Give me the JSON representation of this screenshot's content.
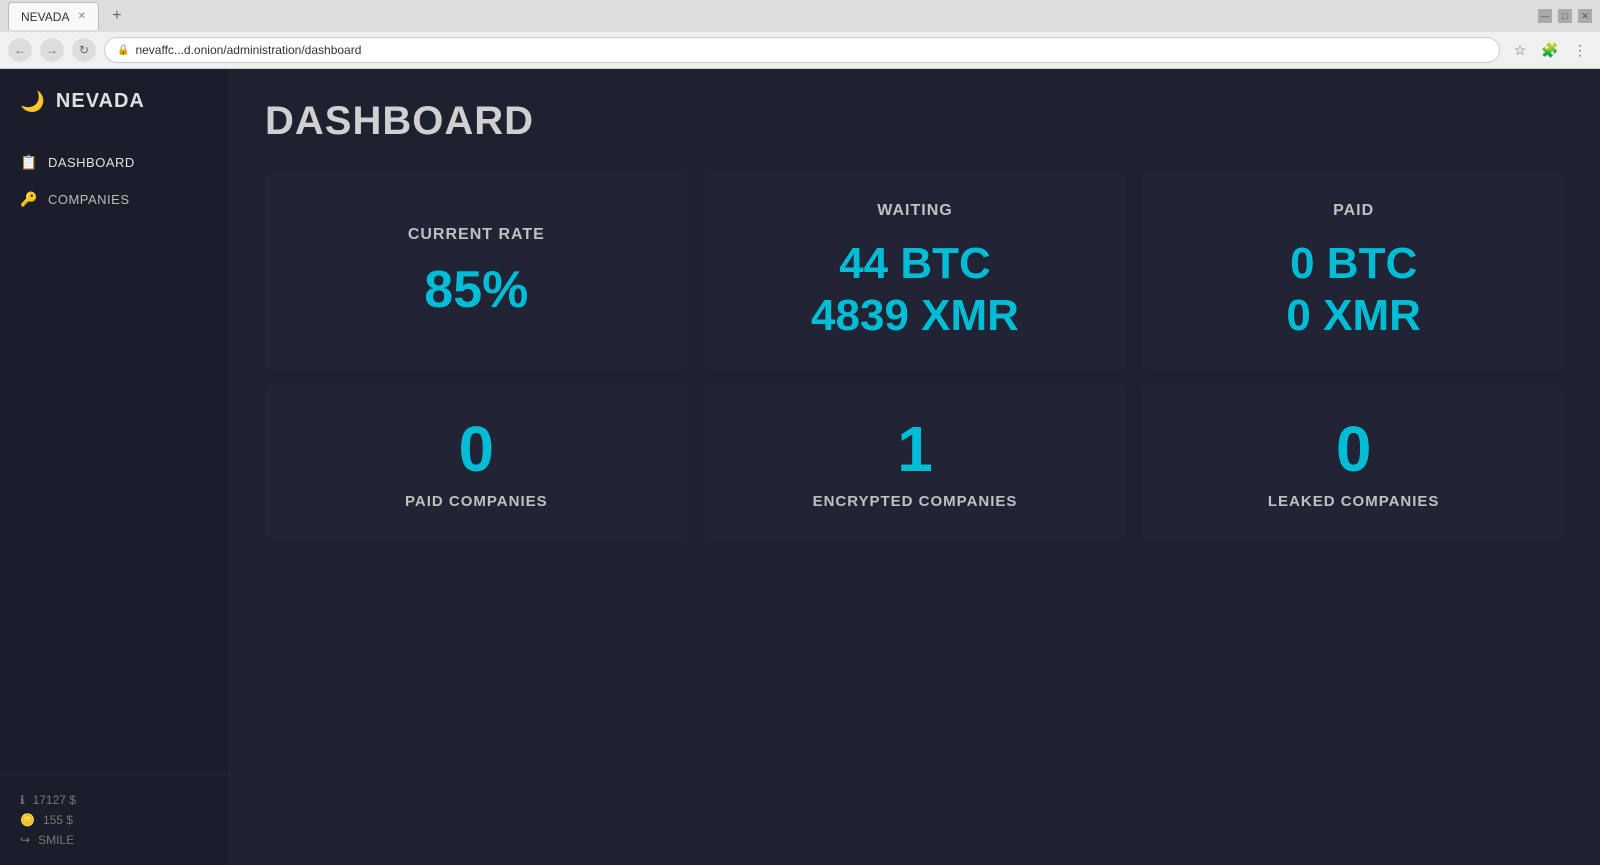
{
  "browser": {
    "tab_title": "NEVADA",
    "url": "nevaffc...d.onion/administration/dashboard",
    "tab_new_label": "+"
  },
  "sidebar": {
    "brand_name": "NEVADA",
    "brand_icon": "🌙",
    "nav_items": [
      {
        "id": "dashboard",
        "label": "DASHBOARD",
        "icon": "📋",
        "active": true
      },
      {
        "id": "companies",
        "label": "COMPANIES",
        "icon": "🔑",
        "active": false
      }
    ],
    "footer": {
      "items": [
        {
          "icon": "ℹ",
          "value": "17127 $"
        },
        {
          "icon": "🪙",
          "value": "155 $"
        },
        {
          "icon": "↪",
          "value": "SMILE"
        }
      ]
    }
  },
  "page": {
    "title": "DASHBOARD"
  },
  "stats": {
    "current_rate": {
      "label": "CURRENT RATE",
      "value": "85%"
    },
    "waiting": {
      "label": "WAITING",
      "btc": "44 BTC",
      "xmr": "4839 XMR"
    },
    "paid": {
      "label": "PAID",
      "btc": "0 BTC",
      "xmr": "0 XMR"
    },
    "paid_companies": {
      "value": "0",
      "label": "PAID COMPANIES"
    },
    "encrypted_companies": {
      "value": "1",
      "label": "ENCRYPTED COMPANIES"
    },
    "leaked_companies": {
      "value": "0",
      "label": "LEAKED COMPANIES"
    }
  },
  "accent_color": "#00bcd4"
}
